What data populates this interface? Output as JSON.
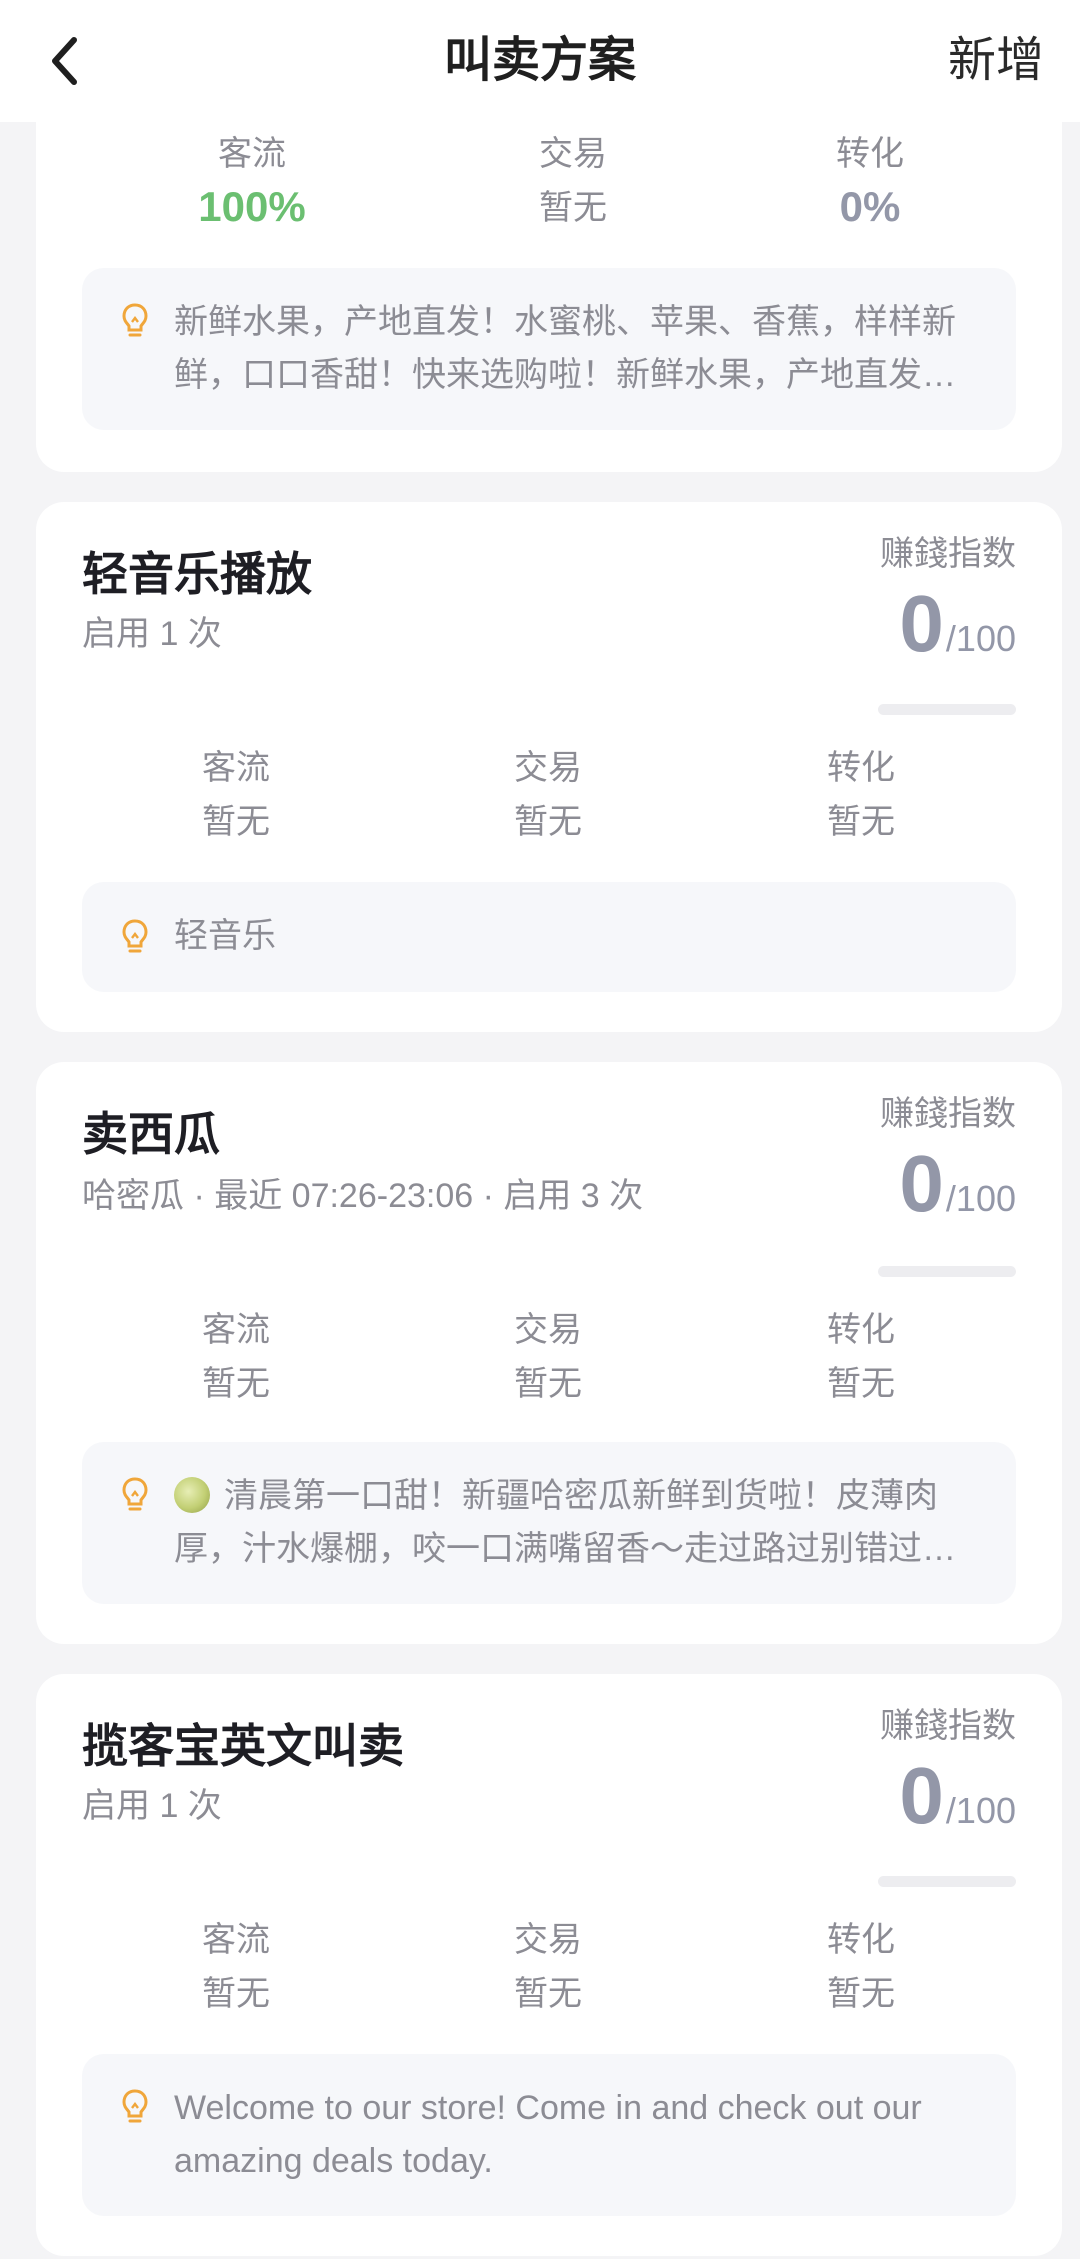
{
  "nav": {
    "title": "叫卖方案",
    "action": "新增"
  },
  "cards": [
    {
      "stats": [
        {
          "label": "客流",
          "value": "100%"
        },
        {
          "label": "交易",
          "value": "暂无"
        },
        {
          "label": "转化",
          "value": "0%"
        }
      ],
      "script": "新鲜水果，产地直发！水蜜桃、苹果、香蕉，样样新鲜，口口香甜！快来选购啦！新鲜水果，产地直发！水蜜桃、苹果、香蕉，样样新鲜"
    },
    {
      "title": "轻音乐播放",
      "meta": "启用 1 次",
      "score_label": "赚錢指数",
      "score": "0",
      "score_max": "/100",
      "score_fraction": 0,
      "stats": [
        {
          "label": "客流",
          "value": "暂无"
        },
        {
          "label": "交易",
          "value": "暂无"
        },
        {
          "label": "转化",
          "value": "暂无"
        }
      ],
      "script": "轻音乐"
    },
    {
      "title": "卖西瓜",
      "meta": "哈密瓜 · 最近 07:26-23:06 · 启用 3 次",
      "score_label": "赚錢指数",
      "score": "0",
      "score_max": "/100",
      "score_fraction": 0,
      "stats": [
        {
          "label": "客流",
          "value": "暂无"
        },
        {
          "label": "交易",
          "value": "暂无"
        },
        {
          "label": "转化",
          "value": "暂无"
        }
      ],
      "script": "清晨第一口甜！新疆哈密瓜新鲜到货啦！皮薄肉厚，汁水爆棚，咬一口满嘴留香～走过路过别错过哦！"
    },
    {
      "title": "揽客宝英文叫卖",
      "meta": "启用 1 次",
      "score_label": "赚錢指数",
      "score": "0",
      "score_max": "/100",
      "score_fraction": 0,
      "stats": [
        {
          "label": "客流",
          "value": "暂无"
        },
        {
          "label": "交易",
          "value": "暂无"
        },
        {
          "label": "转化",
          "value": "暂无"
        }
      ],
      "script": "Welcome to our store! Come in and check out our amazing deals today."
    }
  ],
  "colors": {
    "accent_green": "#6bbf71",
    "score_gray": "#9397a8",
    "bulb_orange": "#f0a63a"
  },
  "icons": {
    "back": "chevron-left-icon",
    "tip": "lightbulb-icon",
    "melon": "melon-emoji"
  }
}
